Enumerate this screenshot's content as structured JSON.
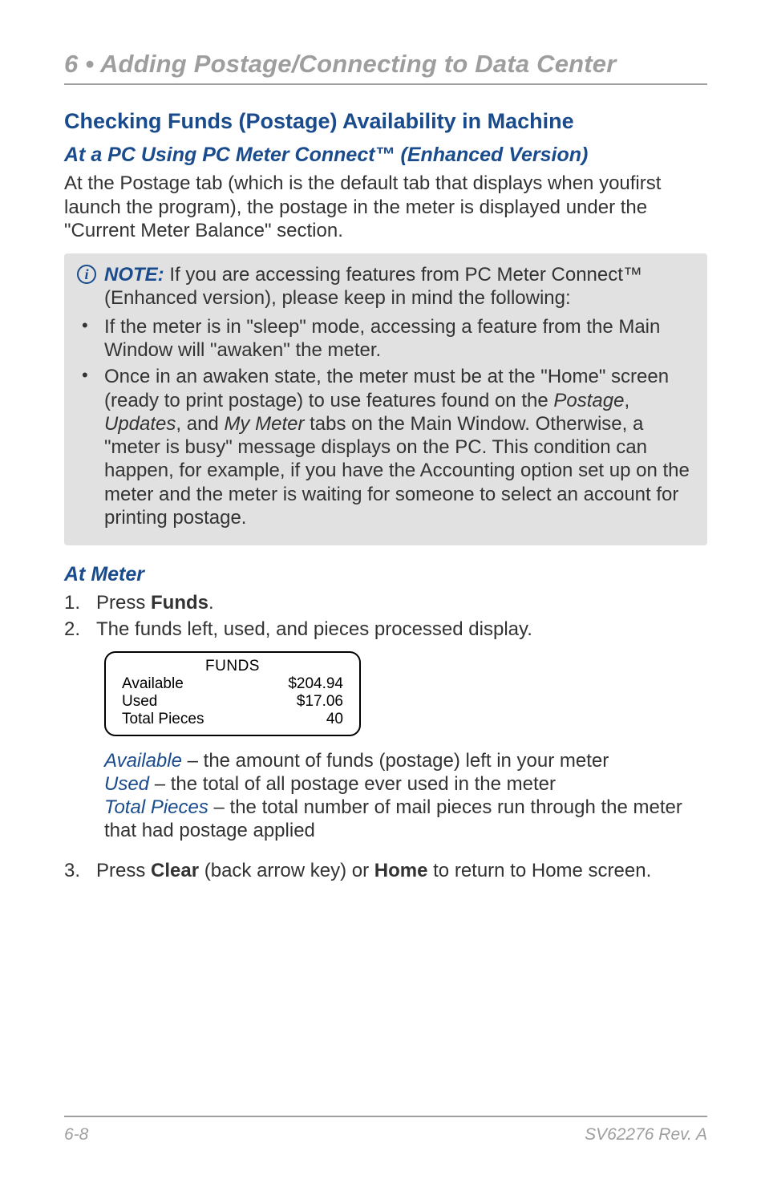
{
  "chapter_title": "6 • Adding Postage/Connecting to Data Center",
  "section_title": "Checking Funds (Postage) Availability in Machine",
  "subsection1_title": "At a PC Using PC Meter Connect™ (Enhanced Version)",
  "intro_paragraph": "At the Postage tab (which is the default tab that displays when you­first launch the program), the postage in the meter is displayed under the \"Current Meter Balance\" section.",
  "note": {
    "label": "NOTE:",
    "intro": " If you are accessing features from PC Meter Connect™ (Enhanced version), please keep in mind the following:",
    "bullets": [
      "If the meter is in \"sleep\" mode, accessing a feature from the Main Window will \"awaken\" the meter.",
      {
        "pre": "Once in an awaken state, the meter must be at the \"Home\" screen (ready to print postage) to use features found on the ",
        "i1": "Postage",
        "c1": ", ",
        "i2": "Updates",
        "c2": ", and ",
        "i3": "My Meter",
        "post": " tabs on the Main Window. Otherwise, a \"meter is busy\" message displays on the PC. This condition can happen, for example, if you have the Accounting option set up on the meter and the meter is waiting for someone to select an account for printing postage."
      }
    ]
  },
  "subsection2_title": "At Meter",
  "steps": {
    "s1": {
      "num": "1.",
      "pre": "Press ",
      "b1": "Funds",
      "post": "."
    },
    "s2": {
      "num": "2.",
      "text": "The funds left, used, and pieces processed display."
    },
    "s3": {
      "num": "3.",
      "pre": "Press ",
      "b1": "Clear",
      "mid": " (back arrow key) or ",
      "b2": "Home",
      "post": " to return to Home screen."
    }
  },
  "chart_data": {
    "type": "table",
    "title": "FUNDS",
    "rows": [
      {
        "label": "Available",
        "value": "$204.94"
      },
      {
        "label": "Used",
        "value": "$17.06"
      },
      {
        "label": "Total Pieces",
        "value": "40"
      }
    ]
  },
  "descriptions": {
    "d1": {
      "label": "Available",
      "text": " – the amount of funds (postage) left in your meter"
    },
    "d2": {
      "label": "Used",
      "text": " – the total of all postage ever used in the meter"
    },
    "d3": {
      "label": "Total Pieces",
      "text": " – the total number of mail pieces run through the meter that had postage applied"
    }
  },
  "footer": {
    "left": "6-8",
    "right": "SV62276 Rev. A"
  }
}
